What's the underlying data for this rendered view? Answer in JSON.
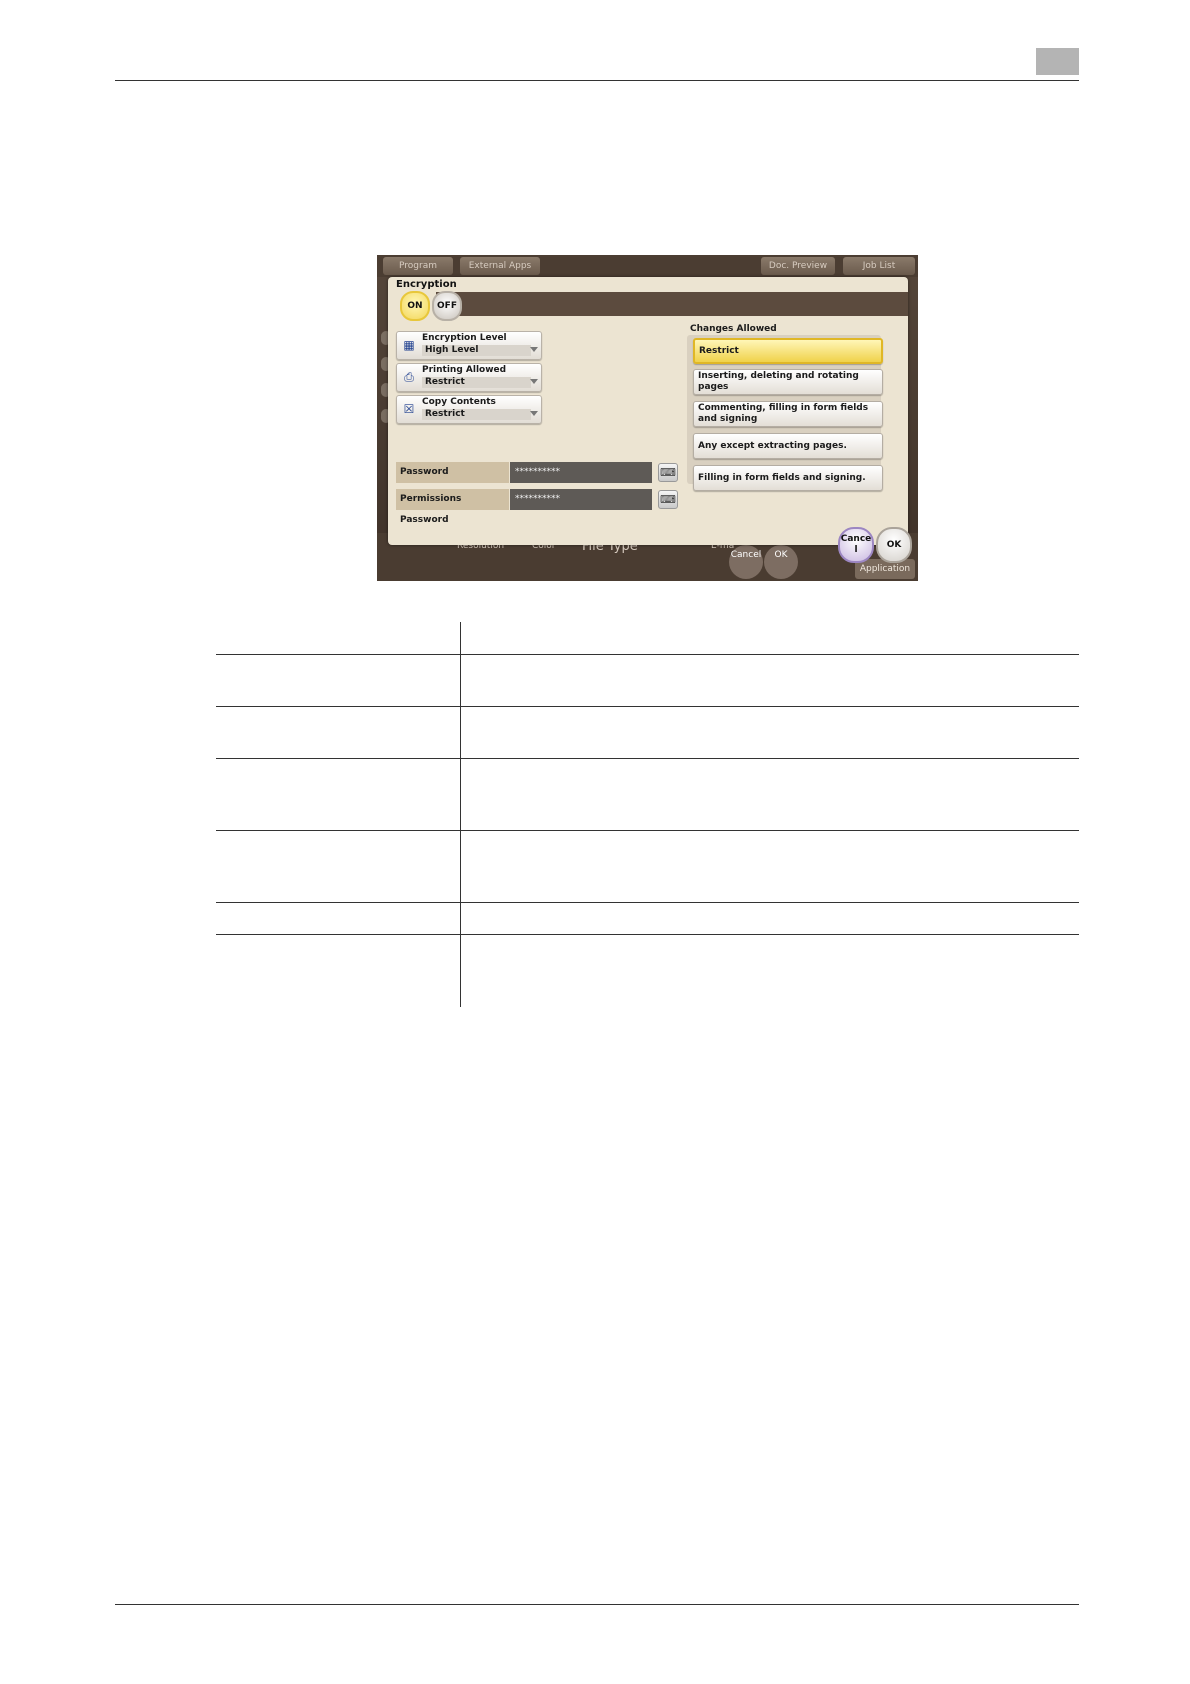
{
  "screen": {
    "topbar": {
      "program": "Program",
      "external_apps": "External Apps",
      "doc_preview": "Doc. Preview",
      "job_list": "Job List"
    },
    "dialog": {
      "title": "Encryption",
      "toggle_on": "ON",
      "toggle_off": "OFF",
      "settings": [
        {
          "label": "Encryption Level",
          "value": "High Level"
        },
        {
          "label": "Printing Allowed",
          "value": "Restrict"
        },
        {
          "label": "Copy Contents",
          "value": "Restrict"
        }
      ],
      "password": {
        "label": "Password",
        "value": "**********"
      },
      "permissions_password": {
        "label": "Permissions Password",
        "value": "**********"
      },
      "changes_allowed": {
        "title": "Changes Allowed",
        "options": [
          "Restrict",
          "Inserting, deleting and rotating pages",
          "Commenting, filling in form fields and signing",
          "Any except extracting pages.",
          "Filling in form fields and signing."
        ],
        "selected_index": 0
      },
      "cancel": "Cance l",
      "ok": "OK"
    },
    "bottombar": {
      "resolution": "Resolution",
      "color": "Color",
      "file_type": "File Type",
      "email": "E-ma",
      "cancel": "Cancel",
      "ok": "OK",
      "application": "Application"
    }
  }
}
